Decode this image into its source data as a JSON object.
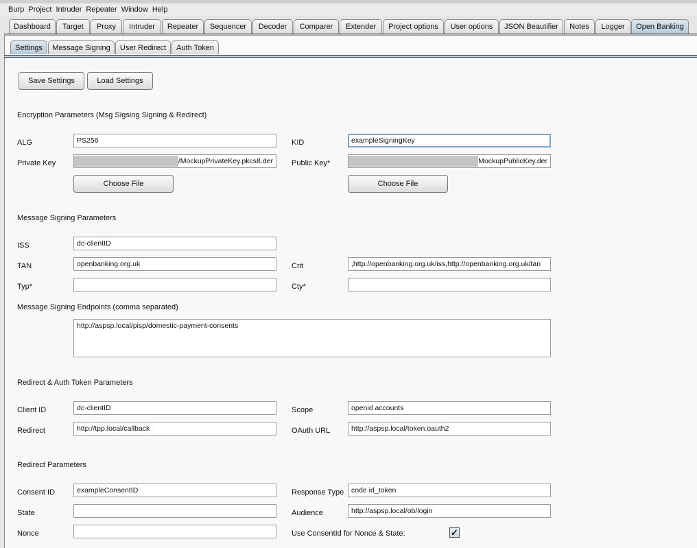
{
  "menu": [
    "Burp",
    "Project",
    "Intruder",
    "Repeater",
    "Window",
    "Help"
  ],
  "main_tabs": [
    "Dashboard",
    "Target",
    "Proxy",
    "Intruder",
    "Repeater",
    "Sequencer",
    "Decoder",
    "Comparer",
    "Extender",
    "Project options",
    "User options",
    "JSON Beautifier",
    "Notes",
    "Logger",
    "Open Banking"
  ],
  "main_tab_active": "Open Banking",
  "sub_tabs": [
    "Settings",
    "Message Signing",
    "User Redirect",
    "Auth Token"
  ],
  "sub_tab_active": "Settings",
  "buttons": {
    "save": "Save Settings",
    "load": "Load Settings",
    "choose_file": "Choose File"
  },
  "sections": {
    "encryption": "Encryption Parameters (Msg Sigsing Signing & Redirect)",
    "signing": "Message Signing Parameters",
    "endpoints": "Message Signing Endpoints (comma separated)",
    "redirect_auth": "Redirect & Auth Token Parameters",
    "redirect": "Redirect Parameters"
  },
  "fields": {
    "alg": {
      "label": "ALG",
      "value": "PS256"
    },
    "kid": {
      "label": "KID",
      "value": "exampleSigningKey"
    },
    "private_key": {
      "label": "Private Key",
      "value": "/MockupPrivateKey.pkcs8.der"
    },
    "public_key": {
      "label": "Public Key*",
      "value": "MockupPublicKey.der"
    },
    "iss": {
      "label": "ISS",
      "value": "dc-clientID"
    },
    "tan": {
      "label": "TAN",
      "value": "openbanking.org.uk"
    },
    "crit": {
      "label": "Crit",
      "value": ",http://openbanking.org.uk/iss,http://openbanking.org.uk/tan"
    },
    "typ": {
      "label": "Typ*",
      "value": ""
    },
    "cty": {
      "label": "Cty*",
      "value": ""
    },
    "endpoints": {
      "value": "http://aspsp.local/pisp/domestic-payment-consents"
    },
    "client_id": {
      "label": "Client ID",
      "value": "dc-clientID"
    },
    "scope": {
      "label": "Scope",
      "value": "openid accounts"
    },
    "redirect": {
      "label": "Redirect",
      "value": "http://tpp.local/callback"
    },
    "oauth_url": {
      "label": "OAuth URL",
      "value": "http://aspsp.local/token.oauth2"
    },
    "consent_id": {
      "label": "Consent ID",
      "value": "exampleConsentID"
    },
    "response_type": {
      "label": "Response Type",
      "value": "code id_token"
    },
    "state": {
      "label": "State",
      "value": ""
    },
    "audience": {
      "label": "Audience",
      "value": "http://aspsp.local/ob/login"
    },
    "nonce": {
      "label": "Nonce",
      "value": ""
    }
  },
  "use_consent_id": {
    "label": "Use ConsentId for Nonce & State:",
    "checked": true,
    "mark": "✓"
  }
}
